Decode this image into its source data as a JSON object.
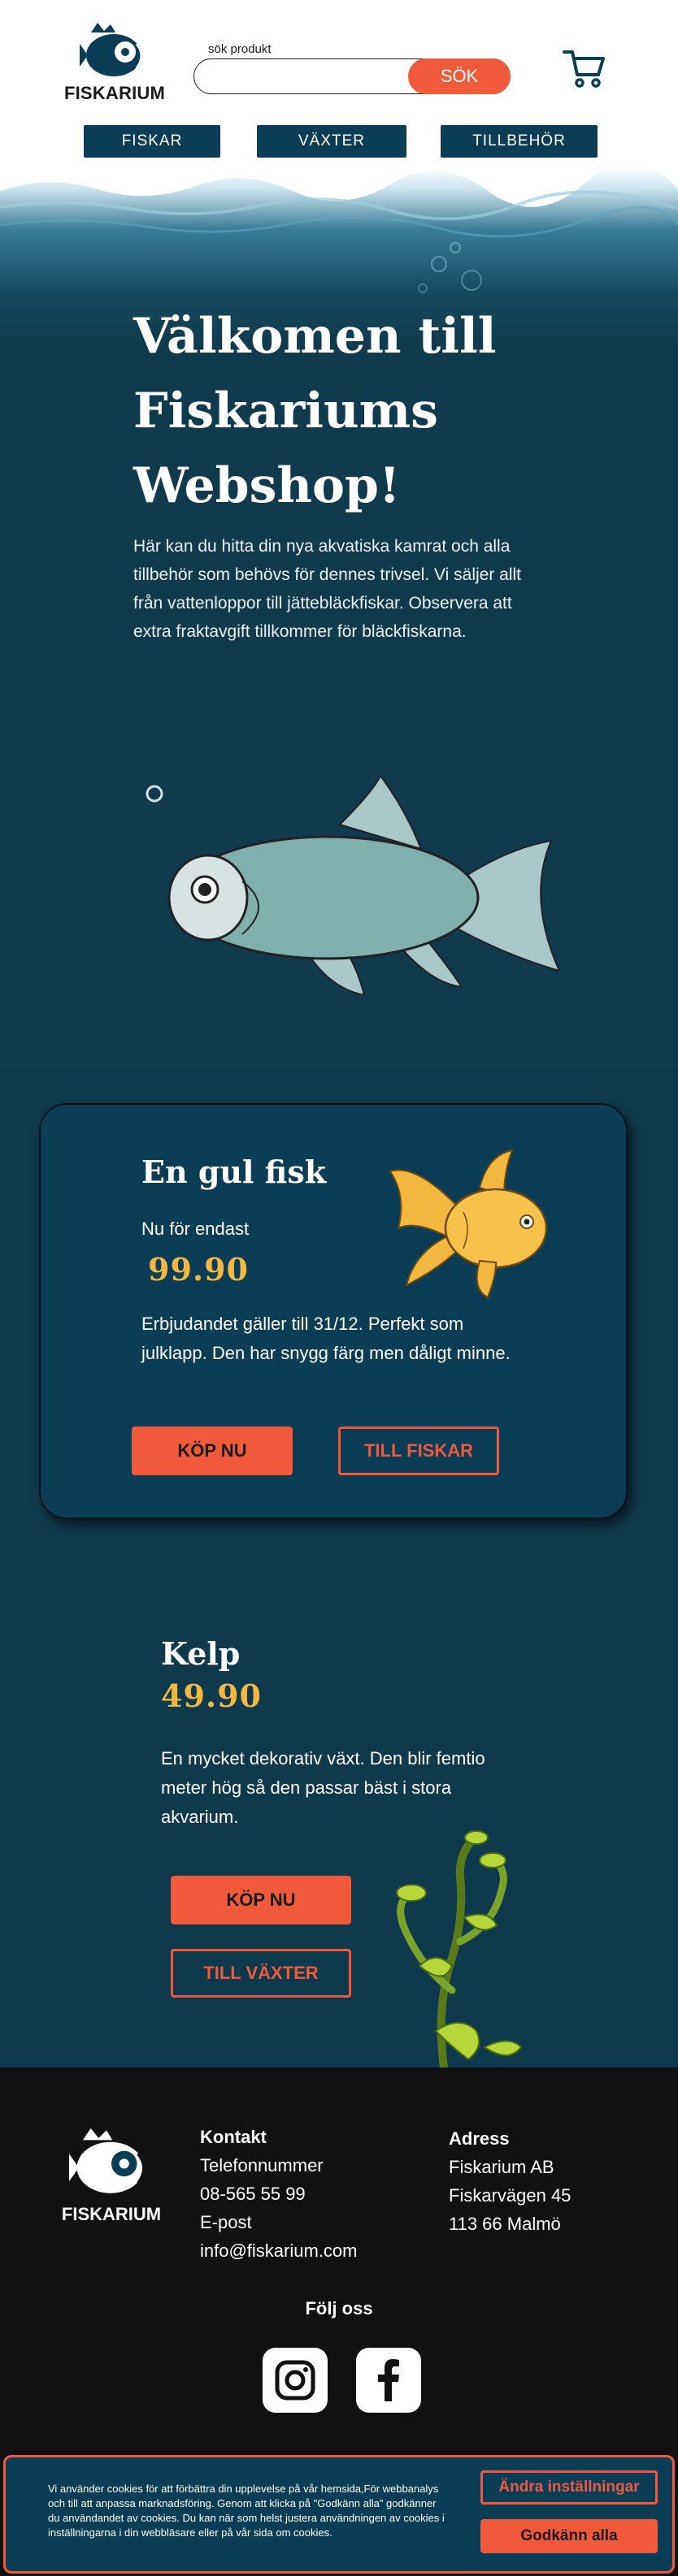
{
  "header": {
    "logo_text": "FISKARIUM",
    "search_label": "sök produkt",
    "search_placeholder": "",
    "search_button": "SÖK"
  },
  "nav": {
    "items": [
      {
        "label": "FISKAR"
      },
      {
        "label": "VÄXTER"
      },
      {
        "label": "TILLBEHÖR"
      }
    ]
  },
  "hero": {
    "title_line1": "Välkomen till",
    "title_line2": "Fiskariums",
    "title_line3": "Webshop!",
    "text": "Här kan du hitta din nya akvatiska kamrat och alla tillbehör som behövs för dennes trivsel. Vi säljer allt från vattenloppor till jättebläckfiskar. Observera att extra fraktavgift tillkommer för bläckfiskarna."
  },
  "offer": {
    "title": "En gul fisk",
    "subtitle": "Nu för  endast",
    "price": "99.90",
    "text": "Erbjudandet gäller till 31/12. Perfekt som julklapp. Den har snygg färg men dåligt minne.",
    "buy_label": "KÖP NU",
    "link_label": "TILL FISKAR"
  },
  "kelp": {
    "title": "Kelp",
    "price": "49.90",
    "text": "En mycket dekorativ växt. Den blir femtio meter hög så den passar bäst i stora akvarium.",
    "buy_label": "KÖP NU",
    "link_label": "TILL VÄXTER"
  },
  "footer": {
    "logo_text": "FISKARIUM",
    "contact": {
      "heading": "Kontakt",
      "phone_label": "Telefonnummer",
      "phone": "08-565 55 99",
      "email_label": "E-post",
      "email": "info@fiskarium.com"
    },
    "address": {
      "heading": "Adress",
      "line1": "Fiskarium AB",
      "line2": "Fiskarvägen 45",
      "line3": "113 66 Malmö"
    },
    "follow": "Följ oss",
    "social": [
      {
        "icon": "instagram-icon"
      },
      {
        "icon": "facebook-icon"
      }
    ]
  },
  "cookie": {
    "text": "Vi använder cookies för att förbättra din upplevelse på vår hemsida,För webbanalys och till att anpassa marknadsföring. Genom att klicka på \"Godkänn alla\" godkänner du användandet av cookies. Du kan när som helst justera användningen av cookies i inställningarna i din webbläsare eller på vår sida om cookies.",
    "settings_label": "Ändra inställningar",
    "accept_label": "Godkänn alla"
  },
  "colors": {
    "accent": "#f05a3a",
    "navy": "#0b3d57",
    "background": "#103a4d",
    "price": "#f4b840",
    "footer": "#111111"
  }
}
